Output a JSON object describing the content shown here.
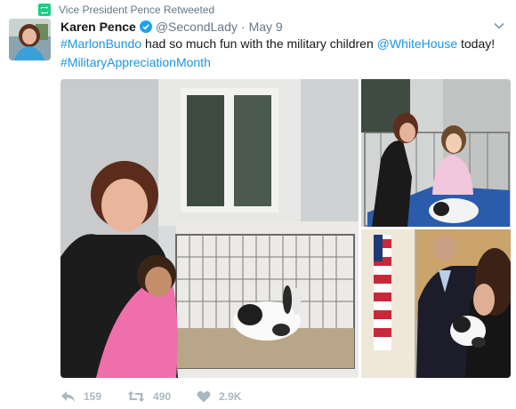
{
  "retweet_notice": "Vice President Pence Retweeted",
  "tweet": {
    "author_name": "Karen Pence",
    "handle": "@SecondLady",
    "separator": "·",
    "date": "May 9",
    "text_parts": [
      "#MarlonBundo",
      " had so much fun with the military children ",
      "@WhiteHouse",
      " today! ",
      "#MilitaryAppreciationMonth"
    ]
  },
  "actions": {
    "replies": "159",
    "retweets": "490",
    "likes": "2.9K"
  },
  "colors": {
    "link": "#1b95e0",
    "retweet_green": "#19cf86",
    "verified_blue": "#1da1f2",
    "muted": "#657786",
    "action_gray": "#aab8c2"
  },
  "icons": [
    "retweet-icon",
    "verified-icon",
    "chevron-down-icon",
    "reply-icon",
    "retweet-action-icon",
    "heart-icon"
  ]
}
